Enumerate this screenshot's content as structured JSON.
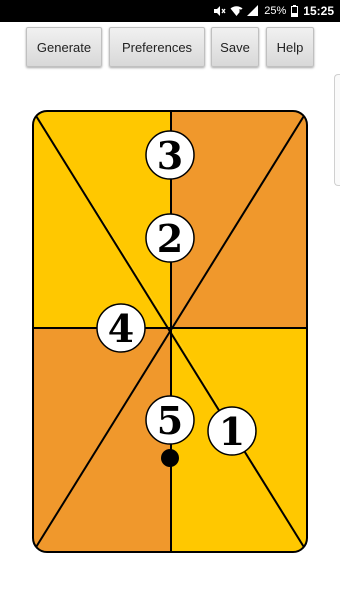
{
  "status_bar": {
    "battery": "25%",
    "time": "15:25",
    "icons": [
      "mute-icon",
      "wifi-icon",
      "signal-icon",
      "battery-icon"
    ]
  },
  "toolbar": {
    "generate_label": "Generate",
    "preferences_label": "Preferences",
    "save_label": "Save",
    "help_label": "Help"
  },
  "board": {
    "colors": {
      "yellow": "#ffc800",
      "orange": "#f0982c",
      "line": "#000000"
    },
    "numbers": [
      "3",
      "2",
      "4",
      "5",
      "1"
    ]
  }
}
